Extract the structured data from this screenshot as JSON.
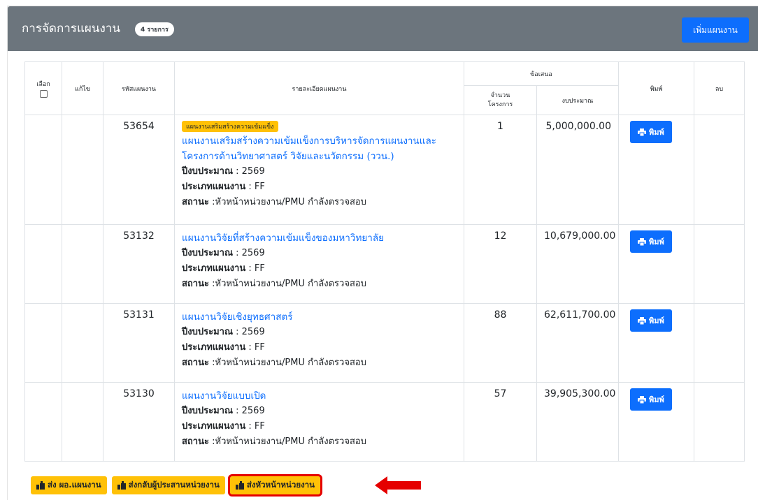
{
  "header": {
    "title": "การจัดการแผนงาน",
    "count_badge": "4 รายการ",
    "add_button": "เพิ่มแผนงาน"
  },
  "table": {
    "headers": {
      "select": "เลือก",
      "edit": "แก้ไข",
      "code": "รหัสแผนงาน",
      "detail": "รายละเอียดแผนงาน",
      "proposal_group": "ข้อเสนอ",
      "project_count": "จำนวน\nโครงการ",
      "budget": "งบประมาณ",
      "print": "พิมพ์",
      "delete": "ลบ"
    },
    "labels": {
      "fiscal_year": "ปีงบประมาณ",
      "plan_type": "ประเภทแผนงาน",
      "status": "สถานะ"
    },
    "rows": [
      {
        "code": "53654",
        "tag": "แผนงานเสริมสร้างความเข้มแข็ง",
        "title": "แผนงานเสริมสร้างความเข้มแข็งการบริหารจัดการแผนงานและโครงการด้านวิทยาศาสตร์ วิจัยและนวัตกรรม (ววน.)",
        "fiscal_year": " : 2569",
        "plan_type": " : FF",
        "status": " :หัวหน้าหน่วยงาน/PMU กำลังตรวจสอบ",
        "project_count": "1",
        "budget": "5,000,000.00",
        "print_label": "พิมพ์"
      },
      {
        "code": "53132",
        "tag": "",
        "title": "แผนงานวิจัยที่สร้างความเข้มแข็งของมหาวิทยาลัย",
        "fiscal_year": " : 2569",
        "plan_type": " : FF",
        "status": " :หัวหน้าหน่วยงาน/PMU กำลังตรวจสอบ",
        "project_count": "12",
        "budget": "10,679,000.00",
        "print_label": "พิมพ์"
      },
      {
        "code": "53131",
        "tag": "",
        "title": "แผนงานวิจัยเชิงยุทธศาสตร์",
        "fiscal_year": " : 2569",
        "plan_type": " : FF",
        "status": " :หัวหน้าหน่วยงาน/PMU กำลังตรวจสอบ",
        "project_count": "88",
        "budget": "62,611,700.00",
        "print_label": "พิมพ์"
      },
      {
        "code": "53130",
        "tag": "",
        "title": "แผนงานวิจัยแบบเปิด",
        "fiscal_year": " : 2569",
        "plan_type": " : FF",
        "status": " :หัวหน้าหน่วยงาน/PMU กำลังตรวจสอบ",
        "project_count": "57",
        "budget": "39,905,300.00",
        "print_label": "พิมพ์"
      }
    ]
  },
  "actions": {
    "send_plan_director": "ส่ง ผอ.แผนงาน",
    "return_coordinator": "ส่งกลับผู้ประสานหน่วยงาน",
    "send_unit_head": "ส่งหัวหน้าหน่วยงาน"
  },
  "colors": {
    "header_bg": "#6c757d",
    "primary": "#0d6efd",
    "warning": "#ffc107",
    "highlight": "#e50000"
  }
}
